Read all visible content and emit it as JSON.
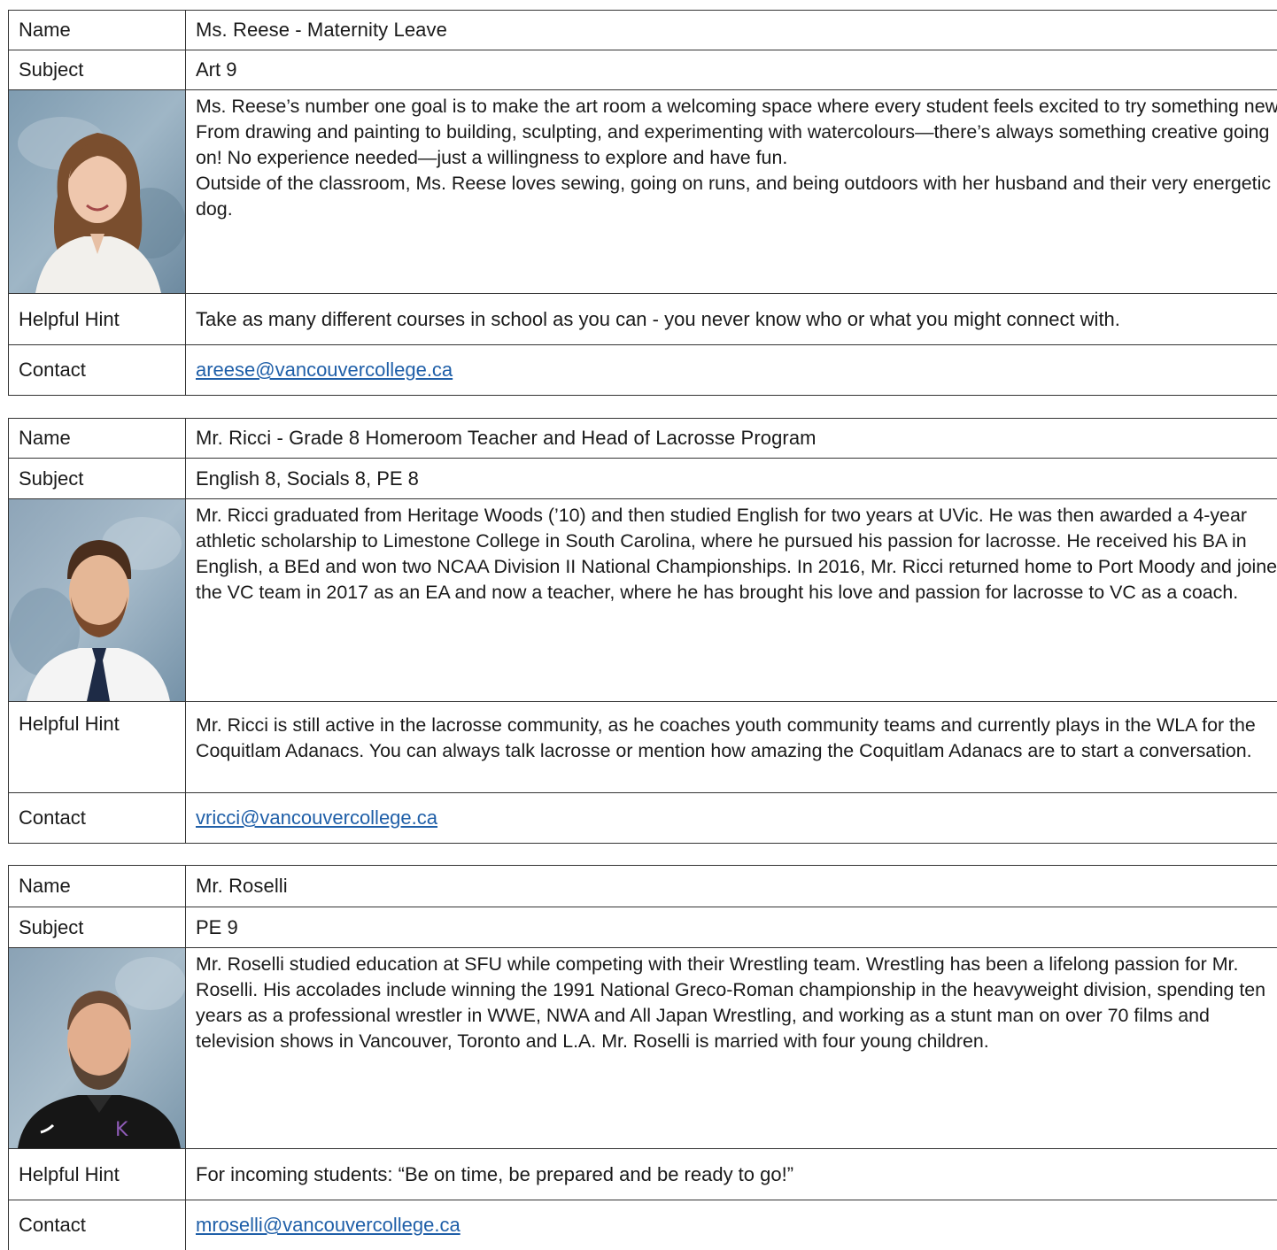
{
  "labels": {
    "name": "Name",
    "subject": "Subject",
    "hint": "Helpful Hint",
    "contact": "Contact"
  },
  "teachers": [
    {
      "name": "Ms. Reese - Maternity Leave",
      "subject": "Art 9",
      "bio": [
        "Ms. Reese’s number one goal is to make the art room a welcoming space where every student feels excited to try something new. From drawing and painting to building, sculpting, and experimenting with watercolours—there’s always something creative going on! No experience needed—just a willingness to explore and have fun.",
        "Outside of the classroom, Ms. Reese loves sewing, going on runs, and being outdoors with her husband and their very energetic dog."
      ],
      "hint": "Take as many different courses in school as you can - you never know who or what you might connect with.",
      "email": "areese@vancouvercollege.ca"
    },
    {
      "name": "Mr. Ricci - Grade 8 Homeroom Teacher and Head of Lacrosse Program",
      "subject": "English 8, Socials 8, PE 8",
      "bio": [
        "Mr. Ricci graduated from Heritage Woods (’10) and then studied English for two years at UVic. He was then awarded a 4-year athletic scholarship to Limestone College in South Carolina, where he pursued his passion for lacrosse. He received his BA in English, a BEd and won two NCAA Division II National Championships. In 2016, Mr. Ricci returned home to Port Moody and joined the VC team in 2017 as an EA and now a teacher, where he has brought his love and passion for lacrosse to VC as a coach."
      ],
      "hint": "Mr. Ricci is still active in the lacrosse community, as he coaches youth community teams and currently plays in the WLA for the Coquitlam Adanacs. You can always talk lacrosse or mention how amazing the Coquitlam Adanacs are to start a conversation.",
      "email": "vricci@vancouvercollege.ca"
    },
    {
      "name": "Mr. Roselli",
      "subject": "PE 9",
      "bio": [
        "Mr. Roselli studied education at SFU while competing with their Wrestling team. Wrestling has been a lifelong passion for Mr. Roselli. His accolades include winning the 1991 National Greco-Roman championship in the heavyweight division, spending ten years as a professional wrestler in WWE, NWA and All Japan Wrestling, and working as a stunt man on over 70 films and television shows in Vancouver, Toronto and L.A. Mr. Roselli is married with four young children."
      ],
      "hint": "For incoming students: “Be on time, be prepared and be ready to go!”",
      "email": "mroselli@vancouvercollege.ca"
    }
  ]
}
